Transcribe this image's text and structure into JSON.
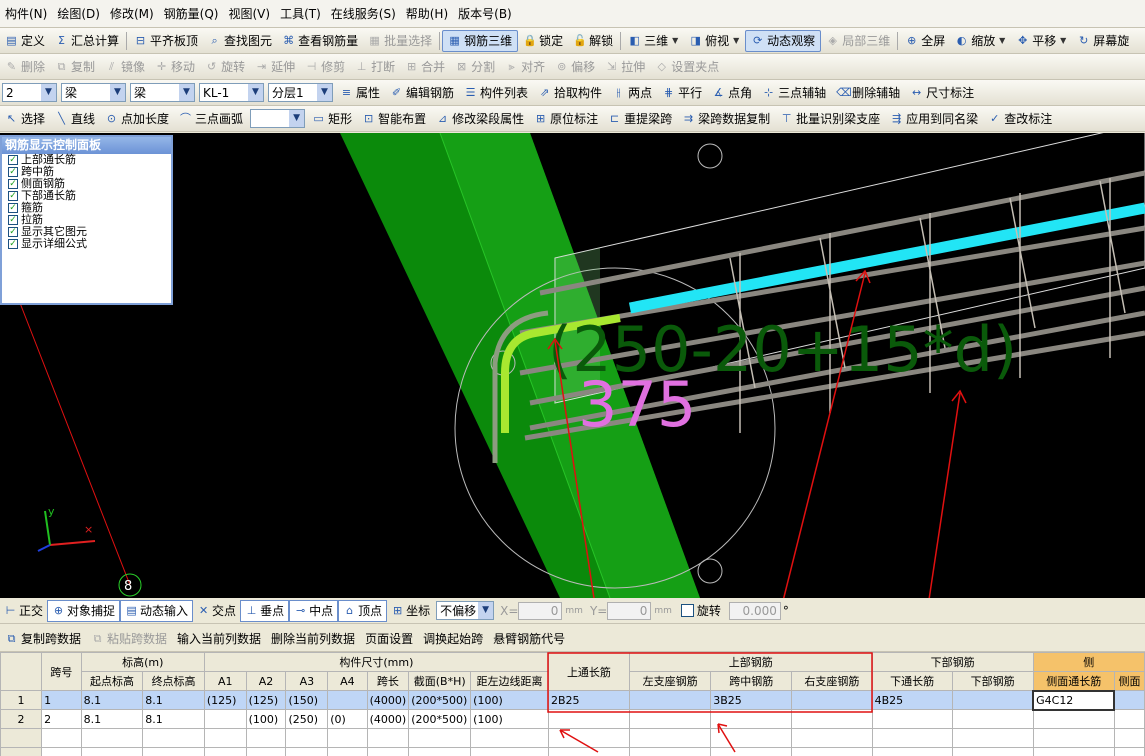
{
  "menu": [
    "构件(N)",
    "绘图(D)",
    "修改(M)",
    "钢筋量(Q)",
    "视图(V)",
    "工具(T)",
    "在线服务(S)",
    "帮助(H)",
    "版本号(B)"
  ],
  "toolbar1": [
    {
      "icon": "define-icon",
      "label": "定义",
      "disabled": false
    },
    {
      "icon": "sigma-icon",
      "label": "汇总计算",
      "disabled": false
    },
    {
      "icon": "align-slab-icon",
      "label": "平齐板顶",
      "disabled": false
    },
    {
      "icon": "find-icon",
      "label": "查找图元",
      "disabled": false
    },
    {
      "icon": "view-rebar-icon",
      "label": "查看钢筋量",
      "disabled": false
    },
    {
      "icon": "batch-select-icon",
      "label": "批量选择",
      "disabled": true
    },
    {
      "icon": "rebar-3d-icon",
      "label": "钢筋三维",
      "disabled": false,
      "active": true
    },
    {
      "icon": "lock-icon",
      "label": "锁定",
      "disabled": false
    },
    {
      "icon": "unlock-icon",
      "label": "解锁",
      "disabled": false
    },
    {
      "icon": "3d-icon",
      "label": "三维",
      "disabled": false,
      "dropdown": true
    },
    {
      "icon": "top-view-icon",
      "label": "俯视",
      "disabled": false,
      "dropdown": true
    },
    {
      "icon": "dynamic-view-icon",
      "label": "动态观察",
      "disabled": false,
      "active": true
    },
    {
      "icon": "local-3d-icon",
      "label": "局部三维",
      "disabled": true
    },
    {
      "icon": "fullscreen-icon",
      "label": "全屏",
      "disabled": false
    },
    {
      "icon": "zoom-icon",
      "label": "缩放",
      "disabled": false,
      "dropdown": true
    },
    {
      "icon": "pan-icon",
      "label": "平移",
      "disabled": false,
      "dropdown": true
    },
    {
      "icon": "screen-rotate-icon",
      "label": "屏幕旋",
      "disabled": false
    }
  ],
  "toolbar2": [
    {
      "icon": "delete-icon",
      "label": "删除"
    },
    {
      "icon": "copy-icon",
      "label": "复制"
    },
    {
      "icon": "mirror-icon",
      "label": "镜像"
    },
    {
      "icon": "move-icon",
      "label": "移动"
    },
    {
      "icon": "rotate-icon",
      "label": "旋转"
    },
    {
      "icon": "extend-icon",
      "label": "延伸"
    },
    {
      "icon": "trim-icon",
      "label": "修剪"
    },
    {
      "icon": "break-icon",
      "label": "打断"
    },
    {
      "icon": "merge-icon",
      "label": "合并"
    },
    {
      "icon": "split-icon",
      "label": "分割"
    },
    {
      "icon": "align-icon",
      "label": "对齐"
    },
    {
      "icon": "offset-icon",
      "label": "偏移"
    },
    {
      "icon": "stretch-icon",
      "label": "拉伸"
    },
    {
      "icon": "grip-icon",
      "label": "设置夹点"
    }
  ],
  "toolbar3": {
    "selects": [
      "2",
      "梁",
      "梁",
      "KL-1",
      "分层1"
    ],
    "buttons": [
      {
        "icon": "properties-icon",
        "label": "属性"
      },
      {
        "icon": "edit-rebar-icon",
        "label": "编辑钢筋"
      },
      {
        "icon": "component-list-icon",
        "label": "构件列表"
      },
      {
        "icon": "pick-icon",
        "label": "拾取构件"
      },
      {
        "icon": "two-point-icon",
        "label": "两点"
      },
      {
        "icon": "parallel-icon",
        "label": "平行"
      },
      {
        "icon": "point-angle-icon",
        "label": "点角"
      },
      {
        "icon": "three-point-axis-icon",
        "label": "三点辅轴"
      },
      {
        "icon": "delete-axis-icon",
        "label": "删除辅轴"
      },
      {
        "icon": "dimension-icon",
        "label": "尺寸标注"
      }
    ]
  },
  "toolbar4": {
    "buttons": [
      {
        "icon": "select-icon",
        "label": "选择"
      },
      {
        "icon": "line-icon",
        "label": "直线"
      },
      {
        "icon": "point-length-icon",
        "label": "点加长度"
      },
      {
        "icon": "arc-icon",
        "label": "三点画弧"
      }
    ],
    "buttons2": [
      {
        "icon": "rectangle-icon",
        "label": "矩形"
      },
      {
        "icon": "smart-layout-icon",
        "label": "智能布置"
      },
      {
        "icon": "span-attr-icon",
        "label": "修改梁段属性"
      },
      {
        "icon": "original-label-icon",
        "label": "原位标注"
      },
      {
        "icon": "re-extract-icon",
        "label": "重提梁跨"
      },
      {
        "icon": "copy-span-icon",
        "label": "梁跨数据复制"
      },
      {
        "icon": "batch-support-icon",
        "label": "批量识别梁支座"
      },
      {
        "icon": "apply-same-icon",
        "label": "应用到同名梁"
      },
      {
        "icon": "check-label-icon",
        "label": "查改标注"
      }
    ]
  },
  "panel": {
    "title": "钢筋显示控制面板",
    "items": [
      "上部通长筋",
      "跨中筋",
      "侧面钢筋",
      "下部通长筋",
      "箍筋",
      "拉筋",
      "显示其它图元",
      "显示详细公式"
    ]
  },
  "view3d": {
    "formula": "(250-20+15*d)",
    "value": "375",
    "axis_label": "8",
    "colors": {
      "column": "#0c8a0c",
      "top_bar": "#20e0f0",
      "formula": "#0a5a0a",
      "value": "#e070e0",
      "annotation": "#e01010"
    }
  },
  "snapbar": {
    "buttons": [
      {
        "icon": "ortho-icon",
        "label": "正交"
      },
      {
        "icon": "object-snap-icon",
        "label": "对象捕捉",
        "active": true
      },
      {
        "icon": "dynamic-input-icon",
        "label": "动态输入",
        "active": true
      },
      {
        "icon": "intersection-icon",
        "label": "交点"
      },
      {
        "icon": "perpendicular-icon",
        "label": "垂点",
        "active": true
      },
      {
        "icon": "midpoint-icon",
        "label": "中点",
        "active": true
      },
      {
        "icon": "vertex-icon",
        "label": "顶点",
        "active": true
      },
      {
        "icon": "coordinate-icon",
        "label": "坐标"
      }
    ],
    "offset_select": "不偏移",
    "x_label": "X=",
    "x_value": "0",
    "y_label": "Y=",
    "y_value": "0",
    "unit": "mm",
    "rotate_label": "旋转",
    "rotate_value": "0.000",
    "degree": "°"
  },
  "tableTb": [
    "复制跨数据",
    "粘贴跨数据",
    "输入当前列数据",
    "删除当前列数据",
    "页面设置",
    "调换起始跨",
    "悬臂钢筋代号"
  ],
  "grid": {
    "headers_top": [
      "跨号",
      "标高(m)",
      "构件尺寸(mm)",
      "上通长筋",
      "上部钢筋",
      "下部钢筋",
      "侧"
    ],
    "headers_sub": [
      "起点标高",
      "终点标高",
      "A1",
      "A2",
      "A3",
      "A4",
      "跨长",
      "截面(B*H)",
      "距左边线距离",
      "左支座钢筋",
      "跨中钢筋",
      "右支座钢筋",
      "下通长筋",
      "下部钢筋",
      "侧面通长筋",
      "侧面"
    ],
    "rows": [
      [
        "1",
        "1",
        "8.1",
        "8.1",
        "(125)",
        "(125)",
        "(150)",
        "",
        "(4000)",
        "(200*500)",
        "(100)",
        "2B25",
        "",
        "3B25",
        "",
        "4B25",
        "",
        "G4C12",
        ""
      ],
      [
        "2",
        "2",
        "8.1",
        "8.1",
        "",
        "(100)",
        "(250)",
        "(0)",
        "(4000)",
        "(200*500)",
        "(100)",
        "",
        "",
        "",
        "",
        "",
        "",
        "",
        ""
      ]
    ]
  }
}
